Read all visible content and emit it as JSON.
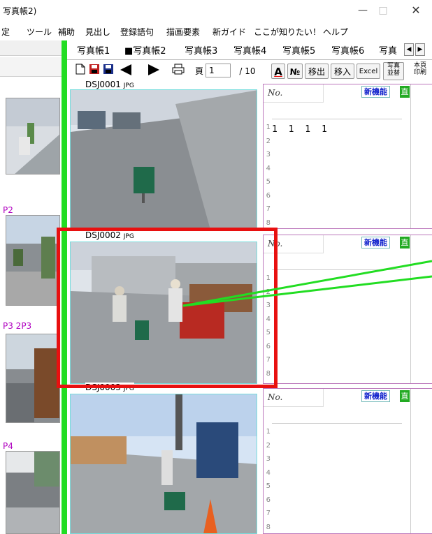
{
  "window": {
    "title": "写真帳2)",
    "minimize": "—",
    "maximize": "□",
    "close": "✕"
  },
  "menu": [
    "定",
    "ツール",
    "補助",
    "見出し",
    "登録語句",
    "描画要素",
    "新ガイド",
    "ここが知りたい！",
    "ヘルプ"
  ],
  "left_panel": {
    "labels": [
      "P2",
      "P3 2P3",
      "P4"
    ]
  },
  "tabs": [
    "写真帳1",
    "■写真帳2",
    "写真帳3",
    "写真帳4",
    "写真帳5",
    "写真帳6",
    "写真"
  ],
  "toolbar": {
    "page_label": "頁",
    "page_current": "1",
    "page_total": "/ 10",
    "numbering": "№",
    "move_out": "移出",
    "move_in": "移入",
    "excel": "Excel",
    "sort_photos": "写真\n並替",
    "print_page": "本頁\n印刷"
  },
  "photos": [
    {
      "id": "DSJ0001",
      "format": "JPG",
      "no_label": "No.",
      "new_feature": "新機能",
      "direct": "直",
      "text": "1 1 1 1",
      "lines": [
        "1",
        "2",
        "3",
        "4",
        "5",
        "6",
        "7",
        "8"
      ]
    },
    {
      "id": "DSJ0002",
      "format": "JPG",
      "no_label": "No.",
      "new_feature": "新機能",
      "direct": "直",
      "text": "",
      "lines": [
        "1",
        "2",
        "3",
        "4",
        "5",
        "6",
        "7",
        "8"
      ]
    },
    {
      "id": "DSJ0003",
      "format": "JPG",
      "no_label": "No.",
      "new_feature": "新機能",
      "direct": "直",
      "text": "",
      "lines": [
        "1",
        "2",
        "3",
        "4",
        "5",
        "6",
        "7",
        "8"
      ]
    }
  ],
  "colors": {
    "accent_green": "#22dd22",
    "selection_red": "#e81010",
    "badge_blue": "#1122cc",
    "label_purple": "#b000c0"
  }
}
